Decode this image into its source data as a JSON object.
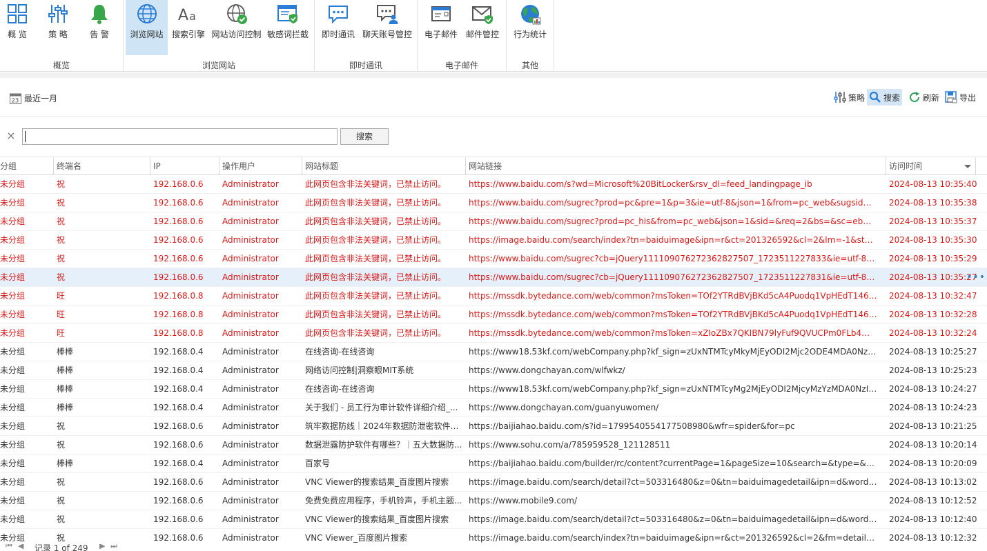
{
  "ribbon": {
    "groups": [
      {
        "label": "概览",
        "buttons": [
          {
            "label": "概 览",
            "icon": "overview-icon"
          },
          {
            "label": "策 略",
            "icon": "policy-sliders-icon"
          },
          {
            "label": "告 警",
            "icon": "alert-bell-icon"
          }
        ]
      },
      {
        "label": "浏览网站",
        "buttons": [
          {
            "label": "浏览网站",
            "icon": "globe-icon",
            "active": true
          },
          {
            "label": "搜索引擎",
            "icon": "font-aa-icon"
          },
          {
            "label": "网站访问控制",
            "icon": "globe-check-icon"
          },
          {
            "label": "敏感词拦截",
            "icon": "shield-window-icon"
          }
        ]
      },
      {
        "label": "即时通讯",
        "buttons": [
          {
            "label": "即时通讯",
            "icon": "chat-bubble-icon"
          },
          {
            "label": "聊天账号管控",
            "icon": "chat-user-icon"
          }
        ]
      },
      {
        "label": "电子邮件",
        "buttons": [
          {
            "label": "电子邮件",
            "icon": "envelope-icon"
          },
          {
            "label": "邮件管控",
            "icon": "envelope-check-icon"
          }
        ]
      },
      {
        "label": "其他",
        "buttons": [
          {
            "label": "行为统计",
            "icon": "globe-stats-icon"
          }
        ]
      }
    ]
  },
  "toolbar": {
    "period_label": "最近一月",
    "calendar_day": "23",
    "policy_label": "策略",
    "search_label": "搜索",
    "refresh_label": "刷新",
    "export_label": "导出"
  },
  "search": {
    "value": "",
    "button_label": "搜索",
    "clear_glyph": "×"
  },
  "grid": {
    "columns": [
      "分组",
      "终端名",
      "IP",
      "操作用户",
      "网站标题",
      "网站链接",
      "访问时间"
    ],
    "sort_column": "访问时间",
    "rows": [
      {
        "group": "未分组",
        "terminal": "祝",
        "ip": "192.168.0.6",
        "user": "Administrator",
        "title": "此网页包含非法关键词，已禁止访问。",
        "url": "https://www.baidu.com/s?wd=Microsoft%20BitLocker&rsv_dl=feed_landingpage_ib",
        "time": "2024-08-13 10:35:40",
        "blocked": true
      },
      {
        "group": "未分组",
        "terminal": "祝",
        "ip": "192.168.0.6",
        "user": "Administrator",
        "title": "此网页包含非法关键词，已禁止访问。",
        "url": "https://www.baidu.com/sugrec?prod=pc&pre=1&p=3&ie=utf-8&json=1&from=pc_web&sugsid=&...",
        "time": "2024-08-13 10:35:38",
        "blocked": true
      },
      {
        "group": "未分组",
        "terminal": "祝",
        "ip": "192.168.0.6",
        "user": "Administrator",
        "title": "此网页包含非法关键词，已禁止访问。",
        "url": "https://www.baidu.com/sugrec?prod=pc_his&from=pc_web&json=1&sid=&req=2&bs=&sc=eb&cs...",
        "time": "2024-08-13 10:35:37",
        "blocked": true
      },
      {
        "group": "未分组",
        "terminal": "祝",
        "ip": "192.168.0.6",
        "user": "Administrator",
        "title": "此网页包含非法关键词，已禁止访问。",
        "url": "https://image.baidu.com/search/index?tn=baiduimage&ipn=r&ct=201326592&cl=2&lm=-1&st=-1&f...",
        "time": "2024-08-13 10:35:30",
        "blocked": true
      },
      {
        "group": "未分组",
        "terminal": "祝",
        "ip": "192.168.0.6",
        "user": "Administrator",
        "title": "此网页包含非法关键词，已禁止访问。",
        "url": "https://www.baidu.com/sugrec?cb=jQuery111109076272362827507_1723511227833&ie=utf-8&wd=...",
        "time": "2024-08-13 10:35:29",
        "blocked": true
      },
      {
        "group": "未分组",
        "terminal": "祝",
        "ip": "192.168.0.6",
        "user": "Administrator",
        "title": "此网页包含非法关键词，已禁止访问。",
        "url": "https://www.baidu.com/sugrec?cb=jQuery111109076272362827507_1723511227831&ie=utf-8&wd=...",
        "time": "2024-08-13 10:35:27",
        "blocked": true,
        "selected": true
      },
      {
        "group": "未分组",
        "terminal": "旺",
        "ip": "192.168.0.8",
        "user": "Administrator",
        "title": "此网页包含非法关键词，已禁止访问。",
        "url": "https://mssdk.bytedance.com/web/common?msToken=TOf2YTRdBVjBKd5cA4Puodq1VpHEdT146ga...",
        "time": "2024-08-13 10:32:47",
        "blocked": true
      },
      {
        "group": "未分组",
        "terminal": "旺",
        "ip": "192.168.0.8",
        "user": "Administrator",
        "title": "此网页包含非法关键词，已禁止访问。",
        "url": "https://mssdk.bytedance.com/web/common?msToken=TOf2YTRdBVjBKd5cA4Puodq1VpHEdT146ga...",
        "time": "2024-08-13 10:32:28",
        "blocked": true
      },
      {
        "group": "未分组",
        "terminal": "旺",
        "ip": "192.168.0.8",
        "user": "Administrator",
        "title": "此网页包含非法关键词，已禁止访问。",
        "url": "https://mssdk.bytedance.com/web/common?msToken=xZIoZBx7QKIBN79lyFuf9QVUCPm0FLb4WNB...",
        "time": "2024-08-13 10:32:24",
        "blocked": true
      },
      {
        "group": "未分组",
        "terminal": "棒棒",
        "ip": "192.168.0.4",
        "user": "Administrator",
        "title": "在线咨询-在线咨询",
        "url": "https://www18.53kf.com/webCompany.php?kf_sign=zUxNTMTcyMkyMjEyODI2Mjc2ODE4MDA0NzI5...",
        "time": "2024-08-13 10:25:27",
        "blocked": false
      },
      {
        "group": "未分组",
        "terminal": "棒棒",
        "ip": "192.168.0.4",
        "user": "Administrator",
        "title": "网络访问控制|洞察眼MIT系统",
        "url": "https://www.dongchayan.com/wlfwkz/",
        "time": "2024-08-13 10:25:23",
        "blocked": false
      },
      {
        "group": "未分组",
        "terminal": "棒棒",
        "ip": "192.168.0.4",
        "user": "Administrator",
        "title": "在线咨询-在线咨询",
        "url": "https://www18.53kf.com/webCompany.php?kf_sign=zUxNTMTcyMg2MjEyODI2MjcyMzYzMDA0NzI5...",
        "time": "2024-08-13 10:24:27",
        "blocked": false
      },
      {
        "group": "未分组",
        "terminal": "棒棒",
        "ip": "192.168.0.4",
        "user": "Administrator",
        "title": "关于我们 - 员工行为审计软件详细介绍_...",
        "url": "https://www.dongchayan.com/guanyuwomen/",
        "time": "2024-08-13 10:24:23",
        "blocked": false
      },
      {
        "group": "未分组",
        "terminal": "祝",
        "ip": "192.168.0.6",
        "user": "Administrator",
        "title": "筑牢数据防线｜2024年数据防泄密软件精...",
        "url": "https://baijiahao.baidu.com/s?id=1799540554177508980&wfr=spider&for=pc",
        "time": "2024-08-13 10:21:25",
        "blocked": false
      },
      {
        "group": "未分组",
        "terminal": "祝",
        "ip": "192.168.0.6",
        "user": "Administrator",
        "title": "数据泄露防护软件有哪些？｜五大数据防...",
        "url": "https://www.sohu.com/a/785959528_121128511",
        "time": "2024-08-13 10:20:14",
        "blocked": false
      },
      {
        "group": "未分组",
        "terminal": "棒棒",
        "ip": "192.168.0.4",
        "user": "Administrator",
        "title": "百家号",
        "url": "https://baijiahao.baidu.com/builder/rc/content?currentPage=1&pageSize=10&search=&type=&colle...",
        "time": "2024-08-13 10:20:09",
        "blocked": false
      },
      {
        "group": "未分组",
        "terminal": "祝",
        "ip": "192.168.0.6",
        "user": "Administrator",
        "title": "VNC Viewer的搜索结果_百度图片搜索",
        "url": "https://image.baidu.com/search/detail?ct=503316480&z=0&tn=baiduimagedetail&ipn=d&word=VN...",
        "time": "2024-08-13 10:13:02",
        "blocked": false
      },
      {
        "group": "未分组",
        "terminal": "祝",
        "ip": "192.168.0.6",
        "user": "Administrator",
        "title": "免费免费应用程序，手机铃声，手机主题...",
        "url": "https://www.mobile9.com/",
        "time": "2024-08-13 10:12:52",
        "blocked": false
      },
      {
        "group": "未分组",
        "terminal": "祝",
        "ip": "192.168.0.6",
        "user": "Administrator",
        "title": "VNC Viewer的搜索结果_百度图片搜索",
        "url": "https://image.baidu.com/search/detail?ct=503316480&z=0&tn=baiduimagedetail&ipn=d&word=VN...",
        "time": "2024-08-13 10:12:40",
        "blocked": false
      },
      {
        "group": "未分组",
        "terminal": "祝",
        "ip": "192.168.0.6",
        "user": "Administrator",
        "title": "VNC Viewer_百度图片搜索",
        "url": "https://image.baidu.com/search/index?tn=baiduimage&ipn=r&ct=201326592&cl=2&fm=detail&lm=...",
        "time": "2024-08-13 10:12:32",
        "blocked": false
      }
    ]
  },
  "pager": {
    "text": "记录 1 of 249",
    "first": "⏮",
    "prev": "◀",
    "next": "▶",
    "last": "⏭"
  },
  "colors": {
    "blocked_text": "#d91a1a",
    "selected_row": "#e5f0fa",
    "active_ribbon": "#cfe4f5",
    "accent_blue": "#2b7cd3"
  }
}
